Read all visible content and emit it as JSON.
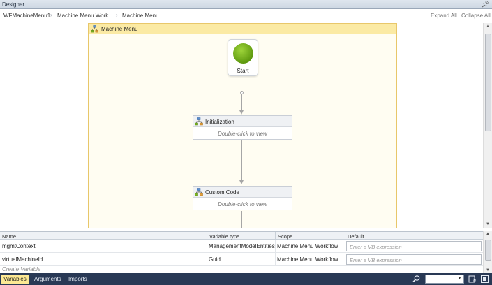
{
  "window": {
    "title": "Designer"
  },
  "breadcrumb": {
    "items": [
      "WFMachineMenu1",
      "Machine Menu Work...",
      "Machine Menu"
    ],
    "expand_all": "Expand All",
    "collapse_all": "Collapse All"
  },
  "flowchart": {
    "title": "Machine Menu",
    "start_label": "Start",
    "activities": [
      {
        "title": "Initialization",
        "hint": "Double-click to view"
      },
      {
        "title": "Custom Code",
        "hint": "Double-click to view"
      }
    ]
  },
  "variables": {
    "columns": [
      "Name",
      "Variable type",
      "Scope",
      "Default"
    ],
    "rows": [
      {
        "name": "mgmtContext",
        "type": "ManagementModelEntities",
        "scope": "Machine Menu Workflow",
        "default_placeholder": "Enter a VB expression"
      },
      {
        "name": "virtualMachineId",
        "type": "Guid",
        "scope": "Machine Menu Workflow",
        "default_placeholder": "Enter a VB expression"
      }
    ],
    "create_placeholder": "Create Variable"
  },
  "bottom_tabs": [
    "Variables",
    "Arguments",
    "Imports"
  ],
  "colors": {
    "accent_tab": "#fce893",
    "bottom_bar": "#293955",
    "flowchart_header": "#fbeaa4",
    "start_node": "#7cb520"
  },
  "icons": [
    "pin-icon",
    "flowchart-icon",
    "start-ball-icon",
    "search-icon",
    "fit-to-screen-icon",
    "overview-icon"
  ]
}
